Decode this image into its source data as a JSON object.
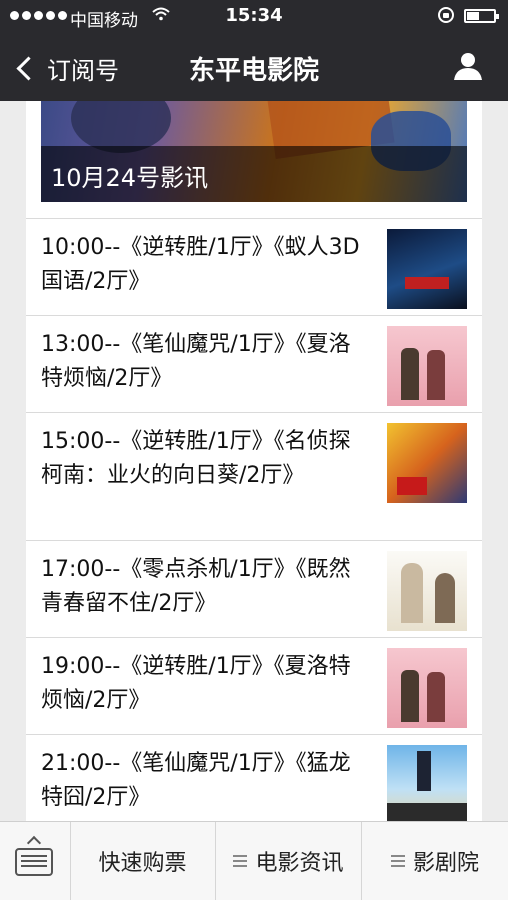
{
  "status_bar": {
    "carrier": "中国移动",
    "time": "15:34"
  },
  "nav": {
    "back_label": "订阅号",
    "title": "东平电影院"
  },
  "banner": {
    "caption": "10月24号影讯"
  },
  "schedule": [
    {
      "text": "10:00--《逆转胜/1厅》《蚁人3D国语/2厅》",
      "thumb": "ant-man-poster"
    },
    {
      "text": "13:00--《笔仙魔咒/1厅》《夏洛特烦恼/2厅》",
      "thumb": "charlotte-poster"
    },
    {
      "text": "15:00--《逆转胜/1厅》《名侦探柯南：业火的向日葵/2厅》",
      "thumb": "conan-poster"
    },
    {
      "text": "17:00--《零点杀机/1厅》《既然青春留不住/2厅》",
      "thumb": "youth-poster"
    },
    {
      "text": "19:00--《逆转胜/1厅》《夏洛特烦恼/2厅》",
      "thumb": "charlotte-poster"
    },
    {
      "text": "21:00--《笔仙魔咒/1厅》《猛龙特囧/2厅》",
      "thumb": "dragon-poster"
    }
  ],
  "bottom_menu": {
    "tab1": "快速购票",
    "tab2": "电影资讯",
    "tab3": "影剧院"
  }
}
